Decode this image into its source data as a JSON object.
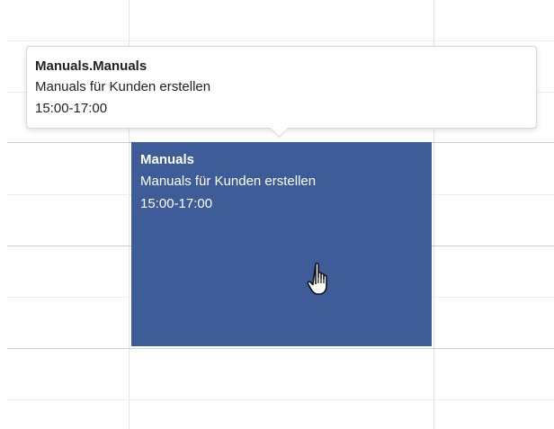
{
  "calendar": {
    "event": {
      "title": "Manuals",
      "description": "Manuals für Kunden erstellen",
      "time": "15:00-17:00",
      "color": "#3d5c98"
    },
    "tooltip": {
      "title": "Manuals.Manuals",
      "description": "Manuals für Kunden erstellen",
      "time": "15:00-17:00"
    },
    "cursor": "hand-pointer-icon"
  }
}
